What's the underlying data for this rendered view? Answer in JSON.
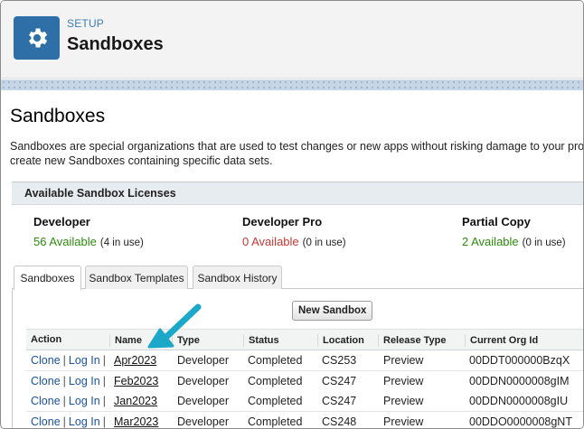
{
  "header": {
    "eyebrow": "SETUP",
    "title": "Sandboxes",
    "icon": "gear-icon"
  },
  "page": {
    "title": "Sandboxes",
    "description_line1": "Sandboxes are special organizations that are used to test changes or new apps without risking damage to your prod",
    "description_line2": "create new Sandboxes containing specific data sets."
  },
  "licenses": {
    "heading": "Available Sandbox Licenses",
    "items": [
      {
        "name": "Developer",
        "available": "56 Available",
        "in_use": "(4 in use)",
        "status_color": "#2e8b0f"
      },
      {
        "name": "Developer Pro",
        "available": "0 Available",
        "in_use": "(0 in use)",
        "status_color": "#c23934"
      },
      {
        "name": "Partial Copy",
        "available": "2 Available",
        "in_use": "(0 in use)",
        "status_color": "#2e8b0f"
      }
    ]
  },
  "tabs": [
    {
      "label": "Sandboxes",
      "active": true
    },
    {
      "label": "Sandbox Templates",
      "active": false
    },
    {
      "label": "Sandbox History",
      "active": false
    }
  ],
  "new_button": "New Sandbox",
  "table": {
    "columns": [
      "Action",
      "Name",
      "Type",
      "Status",
      "Location",
      "Release Type",
      "Current Org Id"
    ],
    "actions": {
      "clone": "Clone",
      "login": "Log In",
      "sep": "|"
    },
    "rows": [
      {
        "name": "Apr2023",
        "type": "Developer",
        "status": "Completed",
        "location": "CS253",
        "release": "Preview",
        "org_id": "00DDT000000BzqX"
      },
      {
        "name": "Feb2023",
        "type": "Developer",
        "status": "Completed",
        "location": "CS247",
        "release": "Preview",
        "org_id": "00DDN0000008gIM"
      },
      {
        "name": "Jan2023",
        "type": "Developer",
        "status": "Completed",
        "location": "CS247",
        "release": "Preview",
        "org_id": "00DDN0000008gIU"
      },
      {
        "name": "Mar2023",
        "type": "Developer",
        "status": "Completed",
        "location": "CS248",
        "release": "Preview",
        "org_id": "00DDO0000008gNT"
      }
    ]
  },
  "colors": {
    "header_icon_bg": "#2e6fa8",
    "link": "#1b5297",
    "annotation_arrow": "#1ba8c9"
  }
}
